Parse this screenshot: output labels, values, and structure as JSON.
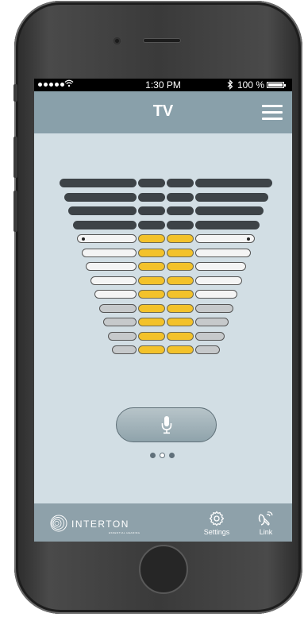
{
  "status_bar": {
    "signal_dots": 5,
    "time": "1:30 PM",
    "bluetooth_icon": "✱",
    "battery": "100 %"
  },
  "header": {
    "title": "TV",
    "menu_icon": "hamburger-menu-icon"
  },
  "volume_display": {
    "total_rows": 13,
    "muted_rows": 4,
    "marker_row": 5,
    "colors": {
      "inactive": "#3d4347",
      "active_center": "#f3c22a",
      "side_on": "#f4f4f4",
      "side_off": "#c6c9cb"
    }
  },
  "mic_button": {
    "icon": "microphone-icon"
  },
  "page_dots": {
    "count": 3,
    "active_index": 1
  },
  "footer": {
    "brand": {
      "name": "INTERTON",
      "tagline": "ESSENTIAL HEARING"
    },
    "nav": [
      {
        "label": "Settings",
        "icon": "gear-icon"
      },
      {
        "label": "Link",
        "icon": "link-signal-icon"
      }
    ]
  },
  "colors": {
    "screen_bg": "#d2dee4",
    "header_bg": "#89a0aa",
    "footer_bg": "#8ea1aa"
  }
}
